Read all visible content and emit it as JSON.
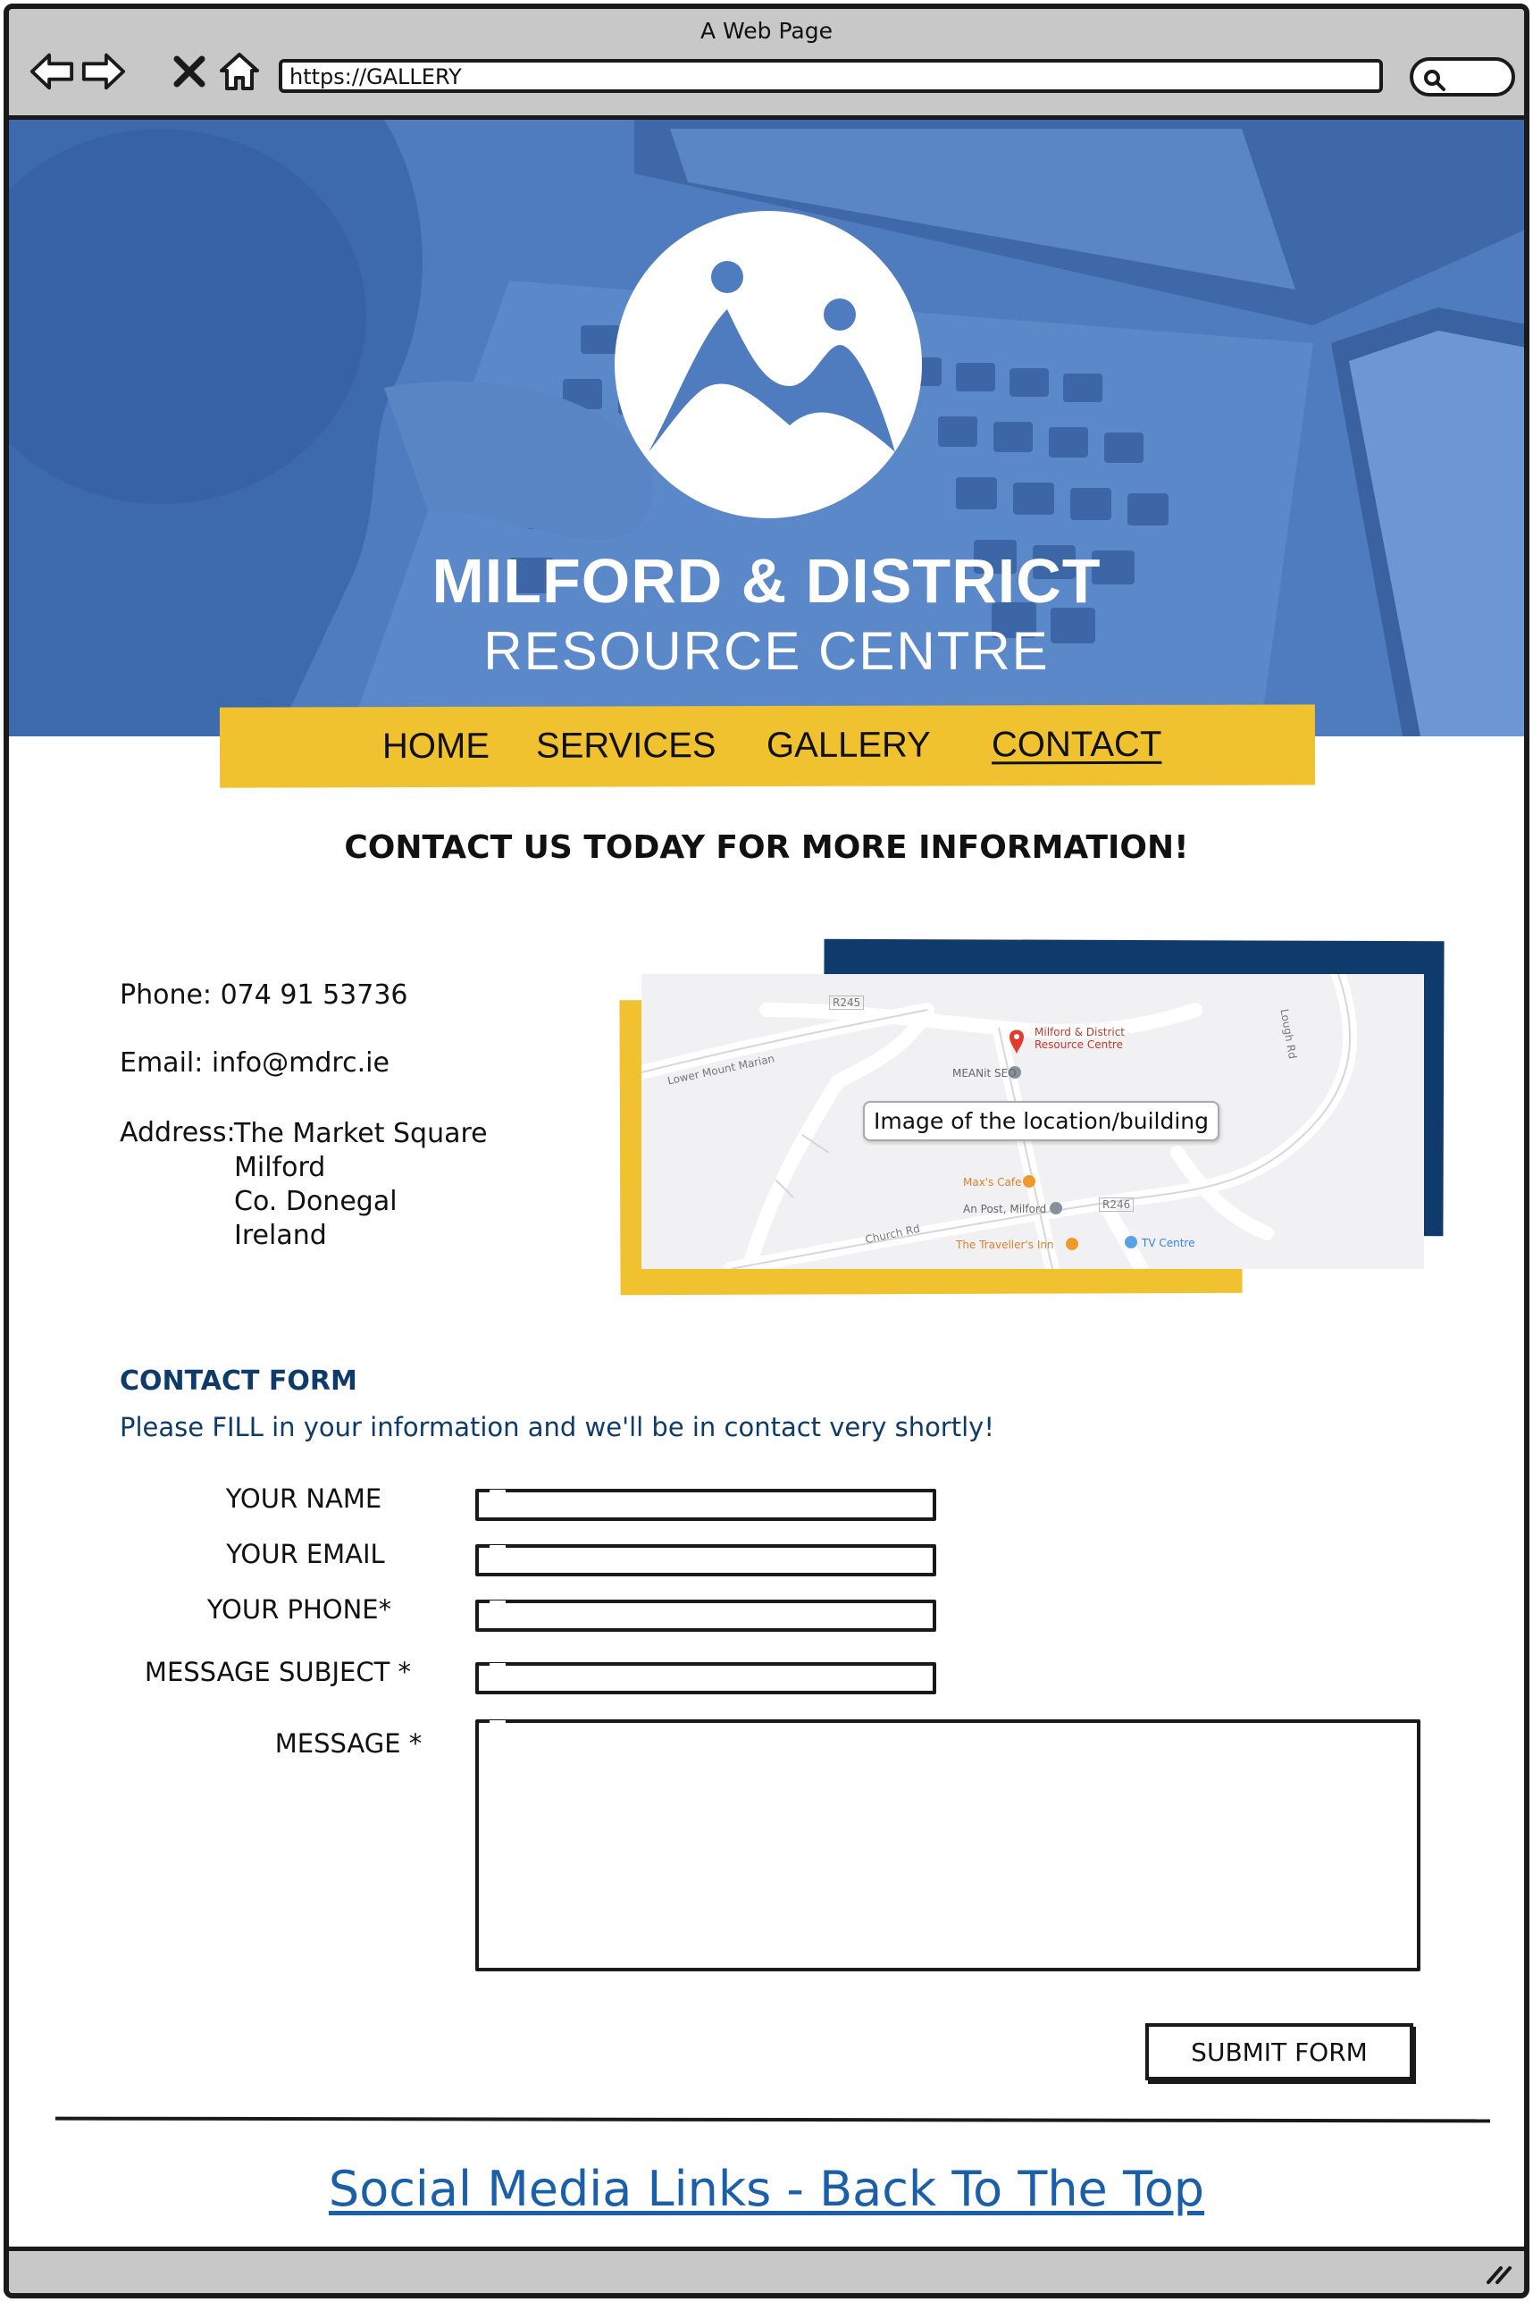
{
  "window": {
    "title": "A Web Page",
    "url": "https://GALLERY"
  },
  "brand": {
    "line1": "MILFORD & DISTRICT",
    "line2": "RESOURCE CENTRE"
  },
  "nav": {
    "items": [
      {
        "label": "HOME"
      },
      {
        "label": "SERVICES"
      },
      {
        "label": "GALLERY"
      },
      {
        "label": "CONTACT",
        "active": true
      }
    ]
  },
  "headline": "CONTACT US TODAY FOR MORE INFORMATION!",
  "contact": {
    "phone": "Phone: 074 91 53736",
    "email": "Email: info@mdrc.ie",
    "address_label": "Address:",
    "address_lines": [
      "The Market Square",
      "Milford",
      "Co. Donegal",
      "Ireland"
    ]
  },
  "map": {
    "label": "Image of the location/building",
    "pois": [
      "Milford & District",
      "Resource Centre",
      "MEANit SEO",
      "Max's Cafe",
      "An Post, Milford",
      "The Traveller's Inn",
      "TV Centre",
      "Church Rd",
      "Lower Mount Marian",
      "R245",
      "R246",
      "Lough Rd"
    ]
  },
  "form": {
    "title": "CONTACT FORM",
    "subtitle": "Please FILL in your information and we'll be in contact very shortly!",
    "fields": [
      {
        "label": "YOUR NAME"
      },
      {
        "label": "YOUR EMAIL"
      },
      {
        "label": "YOUR PHONE*"
      },
      {
        "label": "MESSAGE SUBJECT *"
      },
      {
        "label": "MESSAGE *"
      }
    ],
    "submit_label": "SUBMIT FORM"
  },
  "footer": {
    "link": "Social Media Links - Back To The Top"
  },
  "colors": {
    "hero_blue": "#4f7cbf",
    "nav_yellow": "#f0c22f",
    "navy": "#0e3b6b",
    "link_blue": "#1a5fa8"
  }
}
